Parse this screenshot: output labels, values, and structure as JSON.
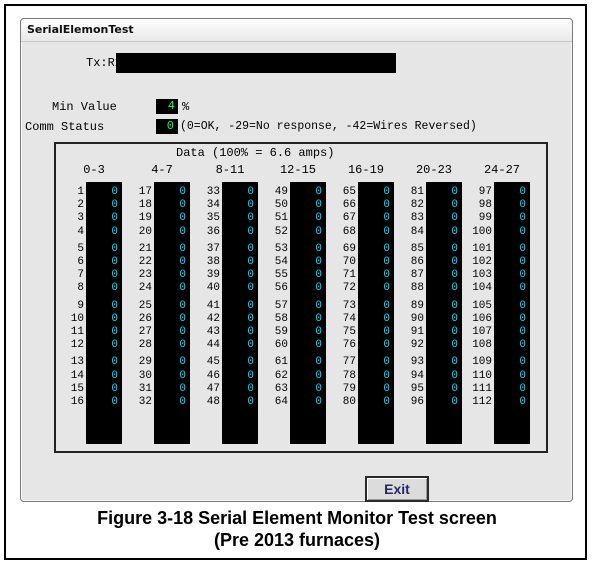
{
  "window": {
    "title": "SerialElemonTest"
  },
  "form": {
    "txrx_label": "Tx:Rx",
    "txrx_value": "",
    "min_value_label": "Min Value",
    "min_value": "4",
    "min_value_unit": "%",
    "comm_status_label": "Comm Status",
    "comm_status_value": "0",
    "comm_status_legend": "(0=OK, -29=No response, -42=Wires Reversed)"
  },
  "data_panel": {
    "title": "Data (100% = 6.6 amps)",
    "ranges": [
      "0-3",
      "4-7",
      "8-11",
      "12-15",
      "16-19",
      "20-23",
      "24-27"
    ],
    "columns": [
      {
        "numbers": [
          "1",
          "2",
          "3",
          "4",
          "5",
          "6",
          "7",
          "8",
          "9",
          "10",
          "11",
          "12",
          "13",
          "14",
          "15",
          "16"
        ],
        "values": [
          "0",
          "0",
          "0",
          "0",
          "0",
          "0",
          "0",
          "0",
          "0",
          "0",
          "0",
          "0",
          "0",
          "0",
          "0",
          "0"
        ]
      },
      {
        "numbers": [
          "17",
          "18",
          "19",
          "20",
          "21",
          "22",
          "23",
          "24",
          "25",
          "26",
          "27",
          "28",
          "29",
          "30",
          "31",
          "32"
        ],
        "values": [
          "0",
          "0",
          "0",
          "0",
          "0",
          "0",
          "0",
          "0",
          "0",
          "0",
          "0",
          "0",
          "0",
          "0",
          "0",
          "0"
        ]
      },
      {
        "numbers": [
          "33",
          "34",
          "35",
          "36",
          "37",
          "38",
          "39",
          "40",
          "41",
          "42",
          "43",
          "44",
          "45",
          "46",
          "47",
          "48"
        ],
        "values": [
          "0",
          "0",
          "0",
          "0",
          "0",
          "0",
          "0",
          "0",
          "0",
          "0",
          "0",
          "0",
          "0",
          "0",
          "0",
          "0"
        ]
      },
      {
        "numbers": [
          "49",
          "50",
          "51",
          "52",
          "53",
          "54",
          "55",
          "56",
          "57",
          "58",
          "59",
          "60",
          "61",
          "62",
          "63",
          "64"
        ],
        "values": [
          "0",
          "0",
          "0",
          "0",
          "0",
          "0",
          "0",
          "0",
          "0",
          "0",
          "0",
          "0",
          "0",
          "0",
          "0",
          "0"
        ]
      },
      {
        "numbers": [
          "65",
          "66",
          "67",
          "68",
          "69",
          "70",
          "71",
          "72",
          "73",
          "74",
          "75",
          "76",
          "77",
          "78",
          "79",
          "80"
        ],
        "values": [
          "0",
          "0",
          "0",
          "0",
          "0",
          "0",
          "0",
          "0",
          "0",
          "0",
          "0",
          "0",
          "0",
          "0",
          "0",
          "0"
        ]
      },
      {
        "numbers": [
          "81",
          "82",
          "83",
          "84",
          "85",
          "86",
          "87",
          "88",
          "89",
          "90",
          "91",
          "92",
          "93",
          "94",
          "95",
          "96"
        ],
        "values": [
          "0",
          "0",
          "0",
          "0",
          "0",
          "0",
          "0",
          "0",
          "0",
          "0",
          "0",
          "0",
          "0",
          "0",
          "0",
          "0"
        ]
      },
      {
        "numbers": [
          "97",
          "98",
          "99",
          "100",
          "101",
          "102",
          "103",
          "104",
          "105",
          "106",
          "107",
          "108",
          "109",
          "110",
          "111",
          "112"
        ],
        "values": [
          "0",
          "0",
          "0",
          "0",
          "0",
          "0",
          "0",
          "0",
          "0",
          "0",
          "0",
          "0",
          "0",
          "0",
          "0",
          "0"
        ]
      }
    ]
  },
  "exit_label": "Exit",
  "caption": {
    "line1": "Figure 3-18  Serial Element Monitor Test screen",
    "line2": "(Pre 2013 furnaces)"
  }
}
